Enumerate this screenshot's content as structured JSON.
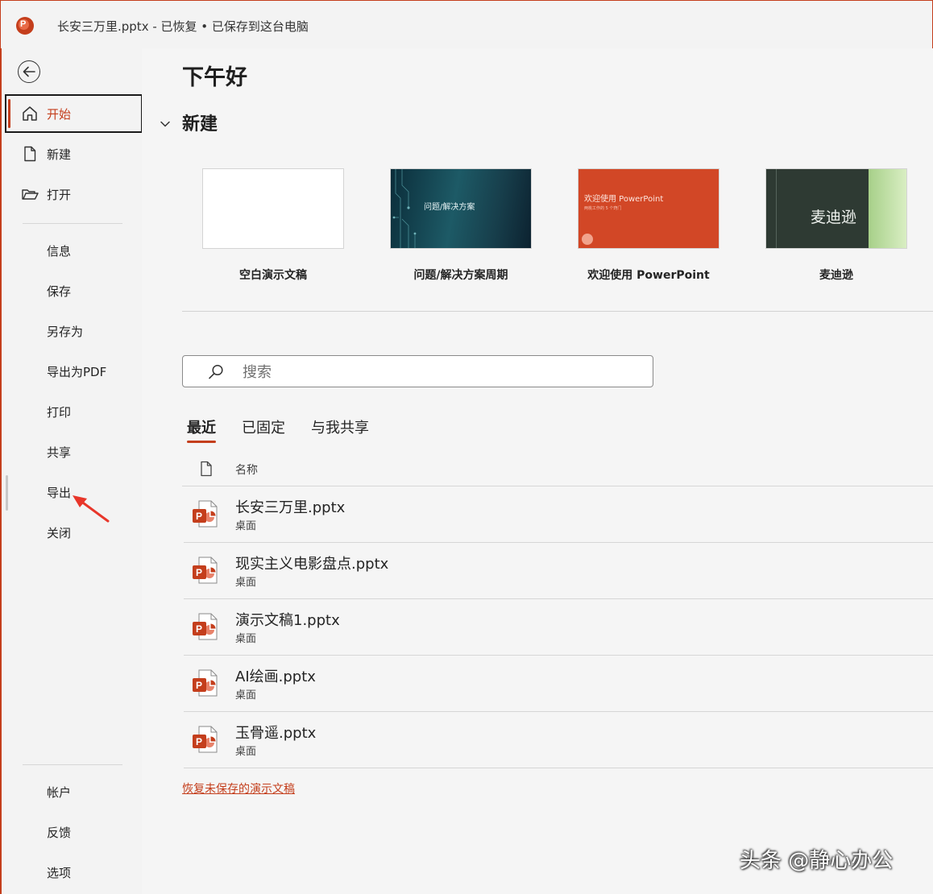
{
  "window": {
    "title": "长安三万里.pptx  -  已恢复 • 已保存到这台电脑",
    "app_icon": "powerpoint-icon"
  },
  "sidebar": {
    "top_items": [
      {
        "label": "开始",
        "icon": "home-icon",
        "active": true
      },
      {
        "label": "新建",
        "icon": "new-document-icon"
      },
      {
        "label": "打开",
        "icon": "folder-open-icon"
      }
    ],
    "middle_items": [
      {
        "label": "信息"
      },
      {
        "label": "保存"
      },
      {
        "label": "另存为"
      },
      {
        "label": "导出为PDF"
      },
      {
        "label": "打印"
      },
      {
        "label": "共享"
      },
      {
        "label": "导出"
      },
      {
        "label": "关闭"
      }
    ],
    "bottom_items": [
      {
        "label": "帐户"
      },
      {
        "label": "反馈"
      },
      {
        "label": "选项"
      }
    ]
  },
  "main": {
    "greeting": "下午好",
    "new_section_label": "新建",
    "templates": [
      {
        "name": "空白演示文稿",
        "thumb_text": ""
      },
      {
        "name": "问题/解决方案周期",
        "thumb_text": "问题/解决方案"
      },
      {
        "name": "欢迎使用 PowerPoint",
        "thumb_text": "欢迎使用 PowerPoint",
        "thumb_subtext": "两桃工作的 5 个窍门"
      },
      {
        "name": "麦迪逊",
        "thumb_text": "麦迪逊"
      }
    ],
    "search": {
      "placeholder": "搜索"
    },
    "tabs": [
      {
        "label": "最近",
        "active": true
      },
      {
        "label": "已固定"
      },
      {
        "label": "与我共享"
      }
    ],
    "file_list": {
      "column_name": "名称",
      "files": [
        {
          "name": "长安三万里.pptx",
          "location": "桌面"
        },
        {
          "name": "现实主义电影盘点.pptx",
          "location": "桌面"
        },
        {
          "name": "演示文稿1.pptx",
          "location": "桌面"
        },
        {
          "name": "AI绘画.pptx",
          "location": "桌面"
        },
        {
          "name": "玉骨遥.pptx",
          "location": "桌面"
        }
      ]
    },
    "recover_link": "恢复未保存的演示文稿"
  },
  "watermark": "头条 @静心办公",
  "colors": {
    "accent": "#c43e1c",
    "background": "#f3f3f3"
  }
}
